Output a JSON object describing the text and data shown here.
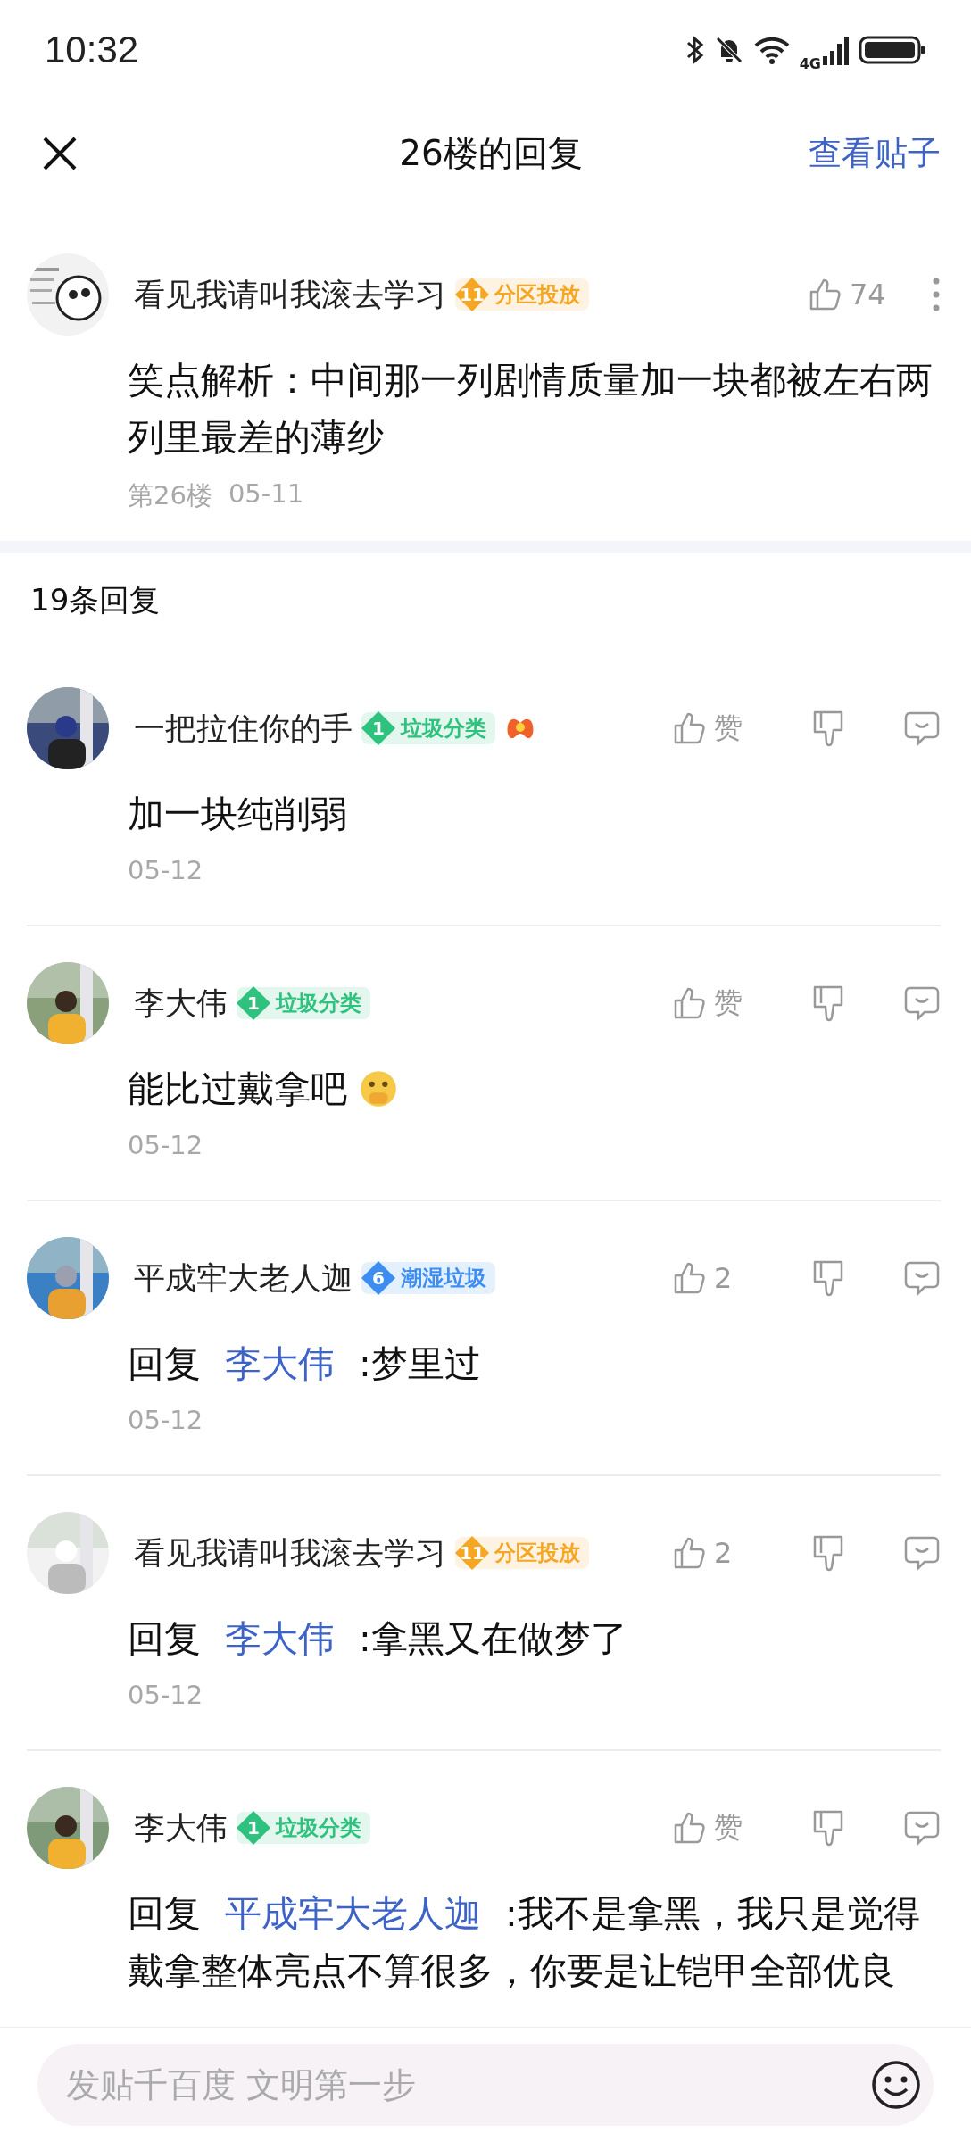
{
  "status_bar": {
    "time": "10:32",
    "network": "4G"
  },
  "header": {
    "title": "26楼的回复",
    "action": "查看贴子"
  },
  "post": {
    "author": "看见我请叫我滚去学习",
    "badge": {
      "level": "11",
      "title": "分区投放",
      "color": "#f5a623"
    },
    "likes": "74",
    "text": "笑点解析：中间那一列剧情质量加一块都被左右两列里最差的薄纱",
    "floor": "第26楼",
    "date": "05-11"
  },
  "replies_count": "19条回复",
  "replies": [
    {
      "author": "一把拉住你的手",
      "badge": {
        "level": "1",
        "title": "垃圾分类",
        "color": "#2ec27e"
      },
      "name_emoji": true,
      "likes": "赞",
      "text": "加一块纯削弱",
      "date": "05-12"
    },
    {
      "author": "李大伟",
      "badge": {
        "level": "1",
        "title": "垃圾分类",
        "color": "#2ec27e"
      },
      "likes": "赞",
      "text": "能比过戴拿吧",
      "text_emoji": true,
      "date": "05-12"
    },
    {
      "author": "平成牢大老人迦",
      "badge": {
        "level": "6",
        "title": "潮湿垃圾",
        "color": "#3d8ef0"
      },
      "likes": "2",
      "reply_prefix": "回复",
      "reply_to": "李大伟",
      "text": ":梦里过",
      "date": "05-12"
    },
    {
      "author": "看见我请叫我滚去学习",
      "badge": {
        "level": "11",
        "title": "分区投放",
        "color": "#f5a623"
      },
      "likes": "2",
      "reply_prefix": "回复",
      "reply_to": "李大伟",
      "text": ":拿黑又在做梦了",
      "date": "05-12"
    },
    {
      "author": "李大伟",
      "badge": {
        "level": "1",
        "title": "垃圾分类",
        "color": "#2ec27e"
      },
      "likes": "赞",
      "reply_prefix": "回复",
      "reply_to": "平成牢大老人迦",
      "text": ":我不是拿黑，我只是觉得戴拿整体亮点不算很多，你要是让铠甲全部优良"
    }
  ],
  "composer": {
    "placeholder": "发贴千百度 文明第一步"
  }
}
